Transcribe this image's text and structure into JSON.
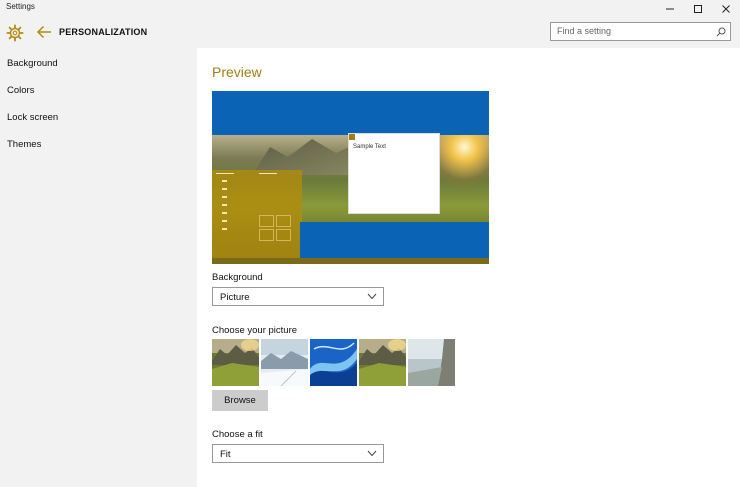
{
  "window": {
    "title": "Settings",
    "controls": {
      "minimize": "—",
      "maximize": "☐",
      "close": "✕"
    }
  },
  "header": {
    "page_title": "PERSONALIZATION",
    "icon": "gear-icon",
    "back_icon": "back-arrow-icon"
  },
  "search": {
    "placeholder": "Find a setting",
    "value": "",
    "icon": "search-icon"
  },
  "sidebar": {
    "items": [
      {
        "label": "Background"
      },
      {
        "label": "Colors"
      },
      {
        "label": "Lock screen"
      },
      {
        "label": "Themes"
      }
    ]
  },
  "main": {
    "preview_title": "Preview",
    "sample_text": "Sample Text",
    "background_label": "Background",
    "background_value": "Picture",
    "choose_picture_label": "Choose your picture",
    "thumbnails": [
      "landscape-hills",
      "snowy-mountains",
      "blue-waves",
      "landscape-hills-2",
      "coastal-cliff"
    ],
    "browse_label": "Browse",
    "fit_label": "Choose a fit",
    "fit_value": "Fit"
  },
  "colors": {
    "accent": "#a07f16",
    "preview_blue": "#0b63b6",
    "chrome_bg": "#f2f2f2"
  }
}
